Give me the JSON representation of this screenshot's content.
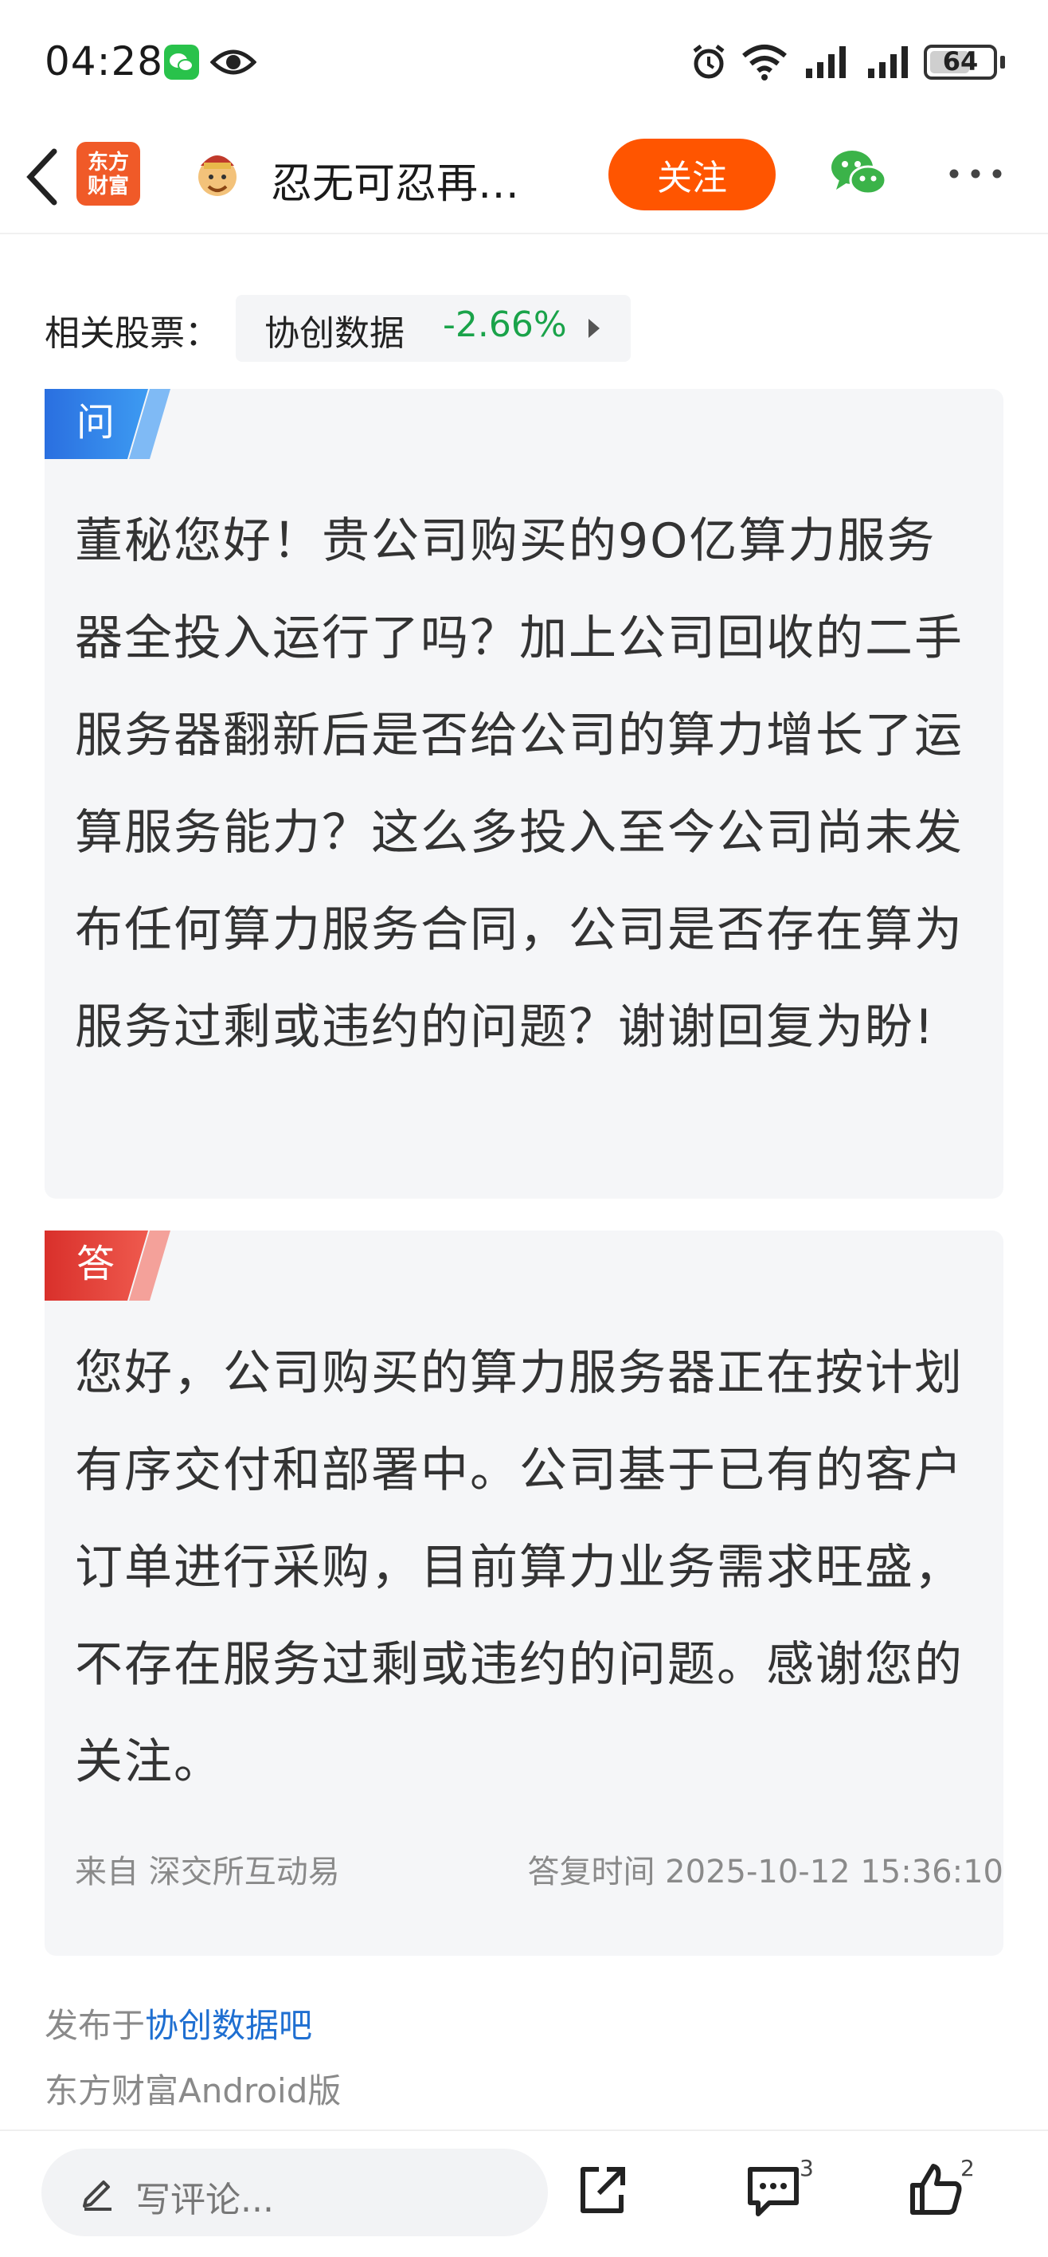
{
  "status_bar": {
    "time": "04:28",
    "battery": "64",
    "battery_level": 0.64
  },
  "nav": {
    "logo_line1": "东方",
    "logo_line2": "财富",
    "title": "忍无可忍再…",
    "follow_label": "关注"
  },
  "related": {
    "label": "相关股票：",
    "stock_name": "协创数据",
    "stock_change": "-2.66%"
  },
  "question": {
    "tag": "问",
    "text": "董秘您好！贵公司购买的9O亿算力服务器全投入运行了吗？加上公司回收的二手服务器翻新后是否给公司的算力增长了运算服务能力？这么多投入至今公司尚未发布任何算力服务合同，公司是否存在算为服务过剩或违约的问题？谢谢回复为盼!"
  },
  "answer": {
    "tag": "答",
    "text": "您好，公司购买的算力服务器正在按计划有序交付和部署中。公司基于已有的客户订单进行采购，目前算力业务需求旺盛，不存在服务过剩或违约的问题。感谢您的关注。",
    "source": "来自 深交所互动易",
    "reply_time": "答复时间 2025-10-12 15:36:10"
  },
  "footer": {
    "published_prefix": "发布于",
    "bar_name": "协创数据吧",
    "client": "东方财富Android版"
  },
  "toolbar": {
    "comment_placeholder": "写评论...",
    "comment_count": "3",
    "like_count": "2"
  },
  "colors": {
    "accent": "#ff5500",
    "question_tag": "#2b7fe0",
    "answer_tag": "#e03a33",
    "stock_down": "#1aa34a",
    "link": "#1f6fd1"
  }
}
